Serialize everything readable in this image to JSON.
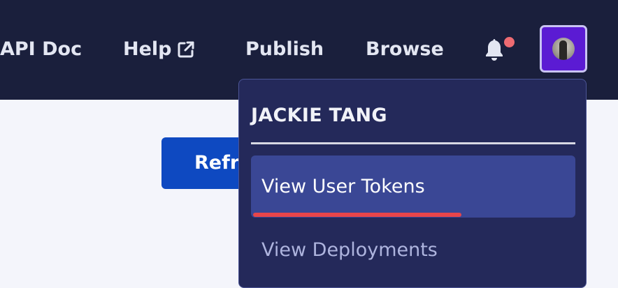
{
  "nav": {
    "api_doc": "API Doc",
    "help": "Help",
    "publish": "Publish",
    "browse": "Browse"
  },
  "notification": {
    "has_unread": true,
    "dot_color": "#ee6b72"
  },
  "main": {
    "refresh_button_label": "Refre"
  },
  "user_menu": {
    "user_name": "JACKIE TANG",
    "items": [
      {
        "label": "View User Tokens",
        "highlighted": true
      },
      {
        "label": "View Deployments",
        "highlighted": false
      }
    ]
  },
  "colors": {
    "topbar": "#1a1f3c",
    "accent_purple": "#5b1bd3",
    "primary_button": "#0e49c1",
    "dropdown_bg": "#24295a",
    "highlight_item": "#3a4795",
    "annotation_underline": "#e8454a"
  },
  "icons": [
    "external-link-icon",
    "bell-icon",
    "avatar"
  ]
}
